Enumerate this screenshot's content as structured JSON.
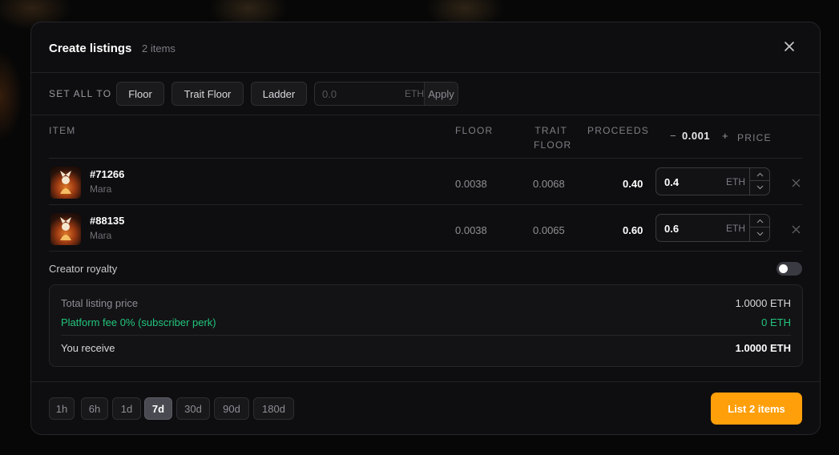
{
  "header": {
    "title": "Create listings",
    "count": "2 items"
  },
  "set_all": {
    "label": "SET ALL TO",
    "buttons": [
      "Floor",
      "Trait Floor",
      "Ladder"
    ],
    "price_placeholder": "0.0",
    "unit": "ETH",
    "apply": "Apply"
  },
  "table": {
    "headers": {
      "item": "ITEM",
      "floor": "FLOOR",
      "trait_floor_1": "TRAIT",
      "trait_floor_2": "FLOOR",
      "proceeds": "PROCEEDS",
      "price": "PRICE"
    },
    "step": {
      "minus": "−",
      "value": "0.001",
      "plus": "+"
    },
    "rows": [
      {
        "id": "#71266",
        "collection": "Mara",
        "floor": "0.0038",
        "trait_floor": "0.0068",
        "proceeds": "0.40",
        "price": "0.4",
        "unit": "ETH"
      },
      {
        "id": "#88135",
        "collection": "Mara",
        "floor": "0.0038",
        "trait_floor": "0.0065",
        "proceeds": "0.60",
        "price": "0.6",
        "unit": "ETH"
      }
    ]
  },
  "royalty": {
    "label": "Creator royalty",
    "enabled": false
  },
  "summary": {
    "total_label": "Total listing price",
    "total_value": "1.0000 ETH",
    "fee_label": "Platform fee 0% (subscriber perk)",
    "fee_value": "0 ETH",
    "receive_label": "You receive",
    "receive_value": "1.0000 ETH",
    "fee_color": "#22c47a"
  },
  "durations": {
    "options": [
      "1h",
      "6h",
      "1d",
      "7d",
      "30d",
      "90d",
      "180d"
    ],
    "selected": "7d"
  },
  "cta": {
    "label": "List 2 items",
    "color": "#ff9f0a"
  }
}
